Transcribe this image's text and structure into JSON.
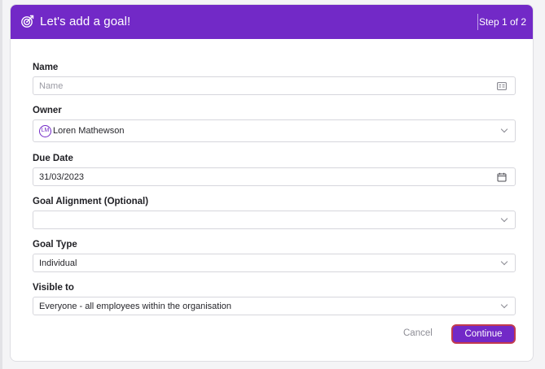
{
  "header": {
    "title": "Let's add a goal!",
    "step": "Step 1 of 2",
    "icon": "target-icon",
    "background": "#7229c7"
  },
  "fields": {
    "name": {
      "label": "Name",
      "placeholder": "Name",
      "value": "",
      "icon": "id-card-icon"
    },
    "owner": {
      "label": "Owner",
      "value": "Loren Mathewson",
      "avatar_initials": "LM"
    },
    "due_date": {
      "label": "Due Date",
      "value": "31/03/2023",
      "icon": "calendar-icon"
    },
    "goal_alignment": {
      "label": "Goal Alignment (Optional)",
      "value": ""
    },
    "goal_type": {
      "label": "Goal Type",
      "value": "Individual"
    },
    "visible_to": {
      "label": "Visible to",
      "value": "Everyone - all employees within the organisation"
    }
  },
  "actions": {
    "cancel_label": "Cancel",
    "continue_label": "Continue",
    "accent_color": "#7229c7",
    "focus_ring_color": "#c23a4e"
  }
}
